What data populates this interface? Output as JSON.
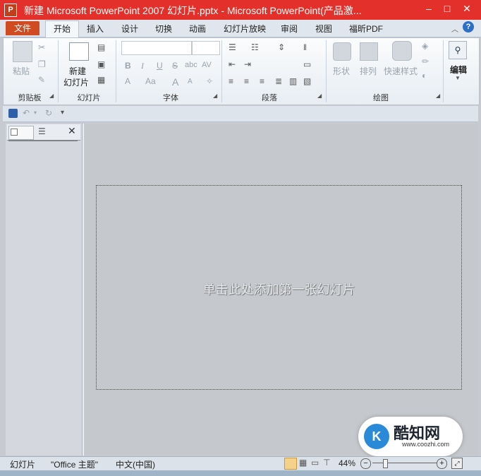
{
  "window": {
    "title": "新建 Microsoft PowerPoint 2007 幻灯片.pptx - Microsoft PowerPoint(产品激...",
    "app_icon": "P",
    "minimize": "–",
    "maximize": "□",
    "close": "✕"
  },
  "tabs": {
    "file": "文件",
    "items": [
      "开始",
      "插入",
      "设计",
      "切换",
      "动画",
      "幻灯片放映",
      "审阅",
      "视图",
      "福昕PDF"
    ]
  },
  "ribbon": {
    "clipboard": {
      "paste": "粘贴",
      "label": "剪贴板"
    },
    "slides": {
      "new_slide_line1": "新建",
      "new_slide_line2": "幻灯片",
      "label": "幻灯片"
    },
    "font": {
      "bold": "B",
      "italic": "I",
      "underline": "U",
      "strike": "S",
      "shadow": "abc",
      "spacing": "AV",
      "font_color": "A",
      "change_case": "Aa",
      "grow": "A",
      "shrink": "A",
      "label": "字体"
    },
    "paragraph": {
      "label": "段落"
    },
    "drawing": {
      "shapes": "形状",
      "arrange": "排列",
      "quick_styles": "快速样式",
      "label": "绘图"
    },
    "editing": {
      "label": "编辑"
    }
  },
  "slide": {
    "placeholder": "单击此处添加第一张幻灯片"
  },
  "statusbar": {
    "view": "幻灯片",
    "theme": "\"Office 主题\"",
    "language": "中文(中国)",
    "zoom": "44%",
    "zoom_minus": "−",
    "zoom_plus": "+"
  },
  "watermark": {
    "brand": "酷知网",
    "url": "www.coozhi.com",
    "logo": "K"
  },
  "colors": {
    "title_bar": "#e4302a",
    "file_tab": "#cf4b21"
  }
}
